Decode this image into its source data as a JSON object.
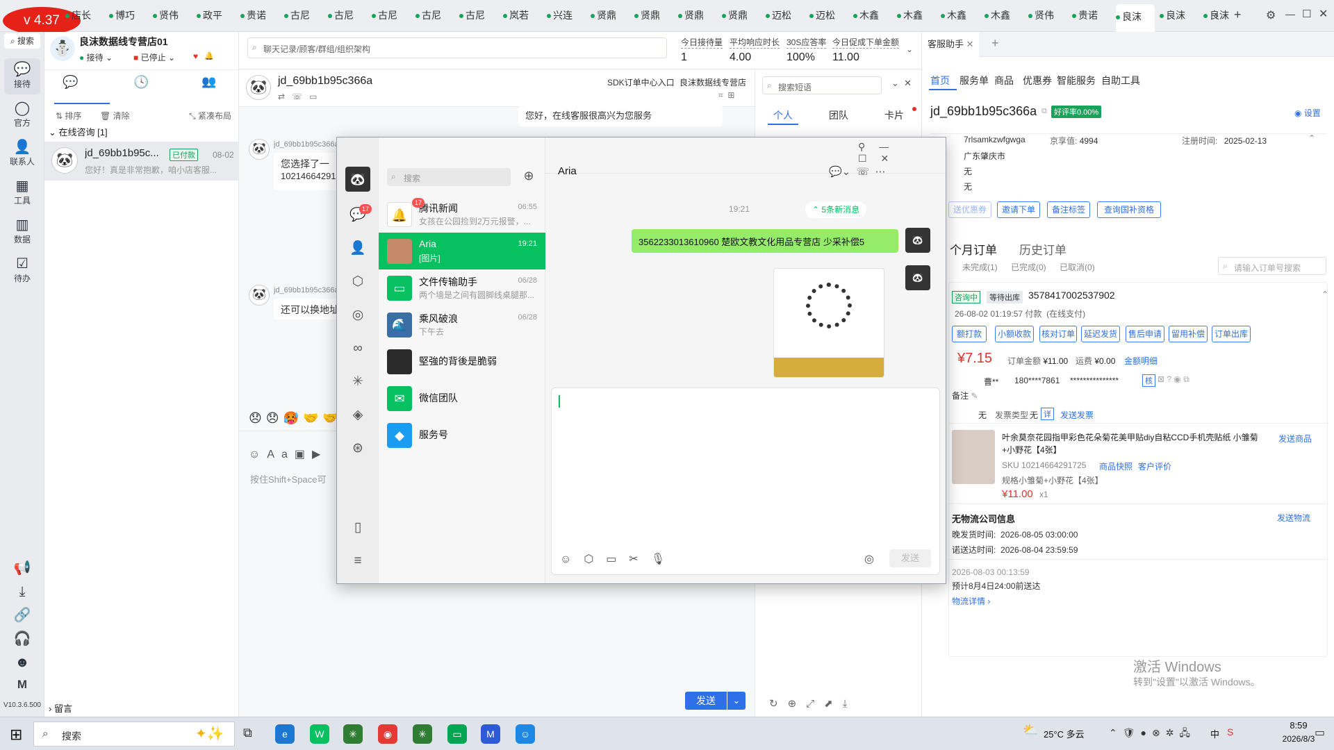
{
  "app": {
    "version": "v 4.37",
    "client_version": "V10.3.6.500",
    "watermark": "良沫数据线专营店"
  },
  "tabs": [
    "店长",
    "博巧",
    "贤伟",
    "政平",
    "贵诺",
    "古尼",
    "古尼",
    "古尼",
    "古尼",
    "古尼",
    "岚若",
    "兴连",
    "贤鼎",
    "贤鼎",
    "贤鼎",
    "贤鼎",
    "迈松",
    "迈松",
    "木鑫",
    "木鑫",
    "木鑫",
    "木鑫",
    "贤伟",
    "贵诺",
    "良沫",
    "良沫",
    "良沫"
  ],
  "active_tab_index": 24,
  "rail": {
    "search": "搜索",
    "items": [
      "接待",
      "官方",
      "联系人",
      "工具",
      "数据",
      "待办"
    ]
  },
  "shop": {
    "name": "良沫数据线专营店01",
    "status_receive": "接待",
    "status_stop": "已停止"
  },
  "conv": {
    "tabs_tools": [
      "排序",
      "清除",
      "紧凑布局"
    ],
    "section": "在线咨询 [1]",
    "item": {
      "name": "jd_69bb1b95c...",
      "tag": "已付款",
      "date": "08-02",
      "preview": "您好！真是非常抱歉，咱小店客服..."
    },
    "footer": "留言"
  },
  "search_placeholder": "聊天记录/顾客/群组/组织架构",
  "stats": [
    {
      "label": "今日接待量",
      "value": "1"
    },
    {
      "label": "平均响应时长",
      "value": "4.00"
    },
    {
      "label": "30S应答率",
      "value": "100%"
    },
    {
      "label": "今日促成下单金额",
      "value": "11.00"
    }
  ],
  "chat": {
    "user": "jd_69bb1b95c366a",
    "sdk_link": "SDK订单中心入口",
    "shop_link": "良沫数据线专营店",
    "msg_top": "您好，在线客服很高兴为您服务",
    "sender": "jd_69bb1b95c366a",
    "msg1": "您选择了一",
    "msg1b": "10214664291",
    "msg2": "还可以换地址",
    "input_placeholder": "按住Shift+Space可",
    "send": "发送"
  },
  "phrases": {
    "search_placeholder": "搜索短语",
    "tabs": [
      "个人",
      "团队",
      "卡片"
    ]
  },
  "right": {
    "title": "客服助手",
    "nav": [
      "首页",
      "服务单",
      "商品",
      "优惠券",
      "智能服务",
      "自助工具"
    ],
    "username": "jd_69bb1b95c366a",
    "rating": "好评率0.00%",
    "settings": "设置",
    "nickname": "7rlsamkzwfgwga",
    "jingxiang_label": "京享值:",
    "jingxiang": "4994",
    "reg_label": "注册时间:",
    "reg": "2025-02-13",
    "city": "广东肇庆市",
    "none1": "无",
    "none2": "无",
    "none3": "无",
    "actions": [
      "送优惠券",
      "邀请下单",
      "备注标签",
      "查询国补资格"
    ],
    "order_tabs": [
      "个月订单",
      "历史订单"
    ],
    "order_sub": [
      "未完成(1)",
      "已完成(0)",
      "已取消(0)"
    ],
    "order_search": "请输入订单号搜索",
    "order_status1": "咨询中",
    "order_status2": "等待出库",
    "order_id": "3578417002537902",
    "order_time": "26-08-02 01:19:57 付款",
    "order_pay": "(在线支付)",
    "order_btns": [
      "额打款",
      "小额收款",
      "核对订单",
      "延迟发货",
      "售后申请",
      "留用补偿",
      "订单出库"
    ],
    "paid": "¥7.15",
    "order_amount_label": "订单金额",
    "order_amount": "¥11.00",
    "freight_label": "运费",
    "freight": "¥0.00",
    "amount_detail": "金额明细",
    "receiver": "曹**",
    "phone": "180****7861",
    "addr": "***************",
    "check": "核",
    "remark": "备注",
    "invoice_status": "无",
    "invoice_type_label": "发票类型",
    "invoice_type": "无",
    "invoice_detail": "详",
    "invoice_send": "发送发票",
    "product_title": "叶余莫奈花园指甲彩色花朵菊花美甲贴diy自粘CCD手机壳贴纸 小雏菊+小野花【4张】",
    "send_product": "发送商品",
    "sku": "SKU 10214664291725",
    "snapshot": "商品快照",
    "review": "客户评价",
    "spec": "规格小雏菊+小野花【4张】",
    "price": "¥11.00",
    "qty": "x1",
    "logistics_title": "无物流公司信息",
    "send_logistics": "发送物流",
    "latest_ship": "晚发货时间:",
    "latest_ship_val": "2026-08-05 03:00:00",
    "promise": "诺送达时间:",
    "promise_val": "2026-08-04 23:59:59",
    "log_time": "2026-08-03 00:13:59",
    "log_text": "预计8月4日24:00前送达",
    "log_detail": "物流详情"
  },
  "windows_activate": {
    "title": "激活 Windows",
    "sub": "转到\"设置\"以激活 Windows。"
  },
  "wechat": {
    "search": "搜索",
    "contact": "Aria",
    "time": "19:21",
    "new_msg": "5条新消息",
    "msg": "3562233013610960 楚欧文教文化用品专营店 少采补偿5",
    "send": "发送",
    "unread": "17",
    "items": [
      {
        "name": "腾讯新闻",
        "time": "06:55",
        "preview": "女孩在公园捡到2万元报警，..."
      },
      {
        "name": "Aria",
        "time": "19:21",
        "preview": "[图片]"
      },
      {
        "name": "文件传输助手",
        "time": "06/28",
        "preview": "两个墙是之间有圆脚线桌腿那..."
      },
      {
        "name": "乘风破浪",
        "time": "06/28",
        "preview": "下午去"
      },
      {
        "name": "堅強的背後是脆弱",
        "time": "",
        "preview": ""
      },
      {
        "name": "微信团队",
        "time": "",
        "preview": ""
      },
      {
        "name": "服务号",
        "time": "",
        "preview": ""
      }
    ]
  },
  "taskbar": {
    "search": "搜索",
    "weather": "25°C 多云",
    "ime": "中",
    "time": "8:59",
    "date": "2026/8/3"
  }
}
